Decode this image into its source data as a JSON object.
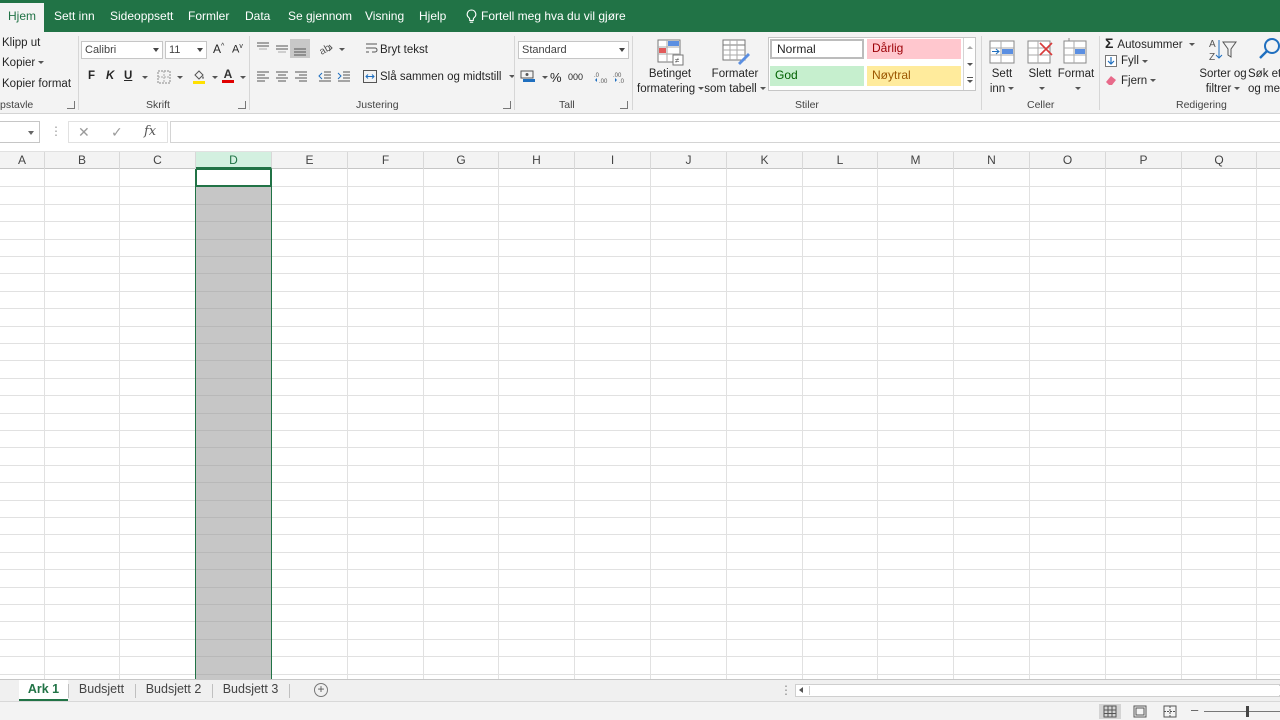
{
  "tabs": [
    {
      "label": "Hjem",
      "active": true
    },
    {
      "label": "Sett inn"
    },
    {
      "label": "Sideoppsett"
    },
    {
      "label": "Formler"
    },
    {
      "label": "Data"
    },
    {
      "label": "Se gjennom"
    },
    {
      "label": "Visning"
    },
    {
      "label": "Hjelp"
    }
  ],
  "tell_me": "Fortell meg hva du vil gjøre",
  "clipboard": {
    "cut": "Klipp ut",
    "copy": "Kopier",
    "format_painter": "Kopier format",
    "group_label": "pstavle"
  },
  "font": {
    "name": "Calibri",
    "size": "11",
    "bold": "F",
    "italic": "K",
    "underline": "U",
    "grow": "A",
    "shrink": "A",
    "color_letter": "A",
    "group_label": "Skrift"
  },
  "alignment": {
    "wrap_text": "Bryt tekst",
    "merge_center": "Slå sammen og midtstill",
    "group_label": "Justering"
  },
  "number": {
    "format": "Standard",
    "percent": "%",
    "thousands": "000",
    "group_label": "Tall"
  },
  "styles": {
    "conditional": [
      "Betinget",
      "formatering"
    ],
    "as_table": [
      "Formater",
      "som tabell"
    ],
    "normal": "Normal",
    "bad": "Dårlig",
    "good": "God",
    "neutral": "Nøytral",
    "group_label": "Stiler"
  },
  "cells": {
    "insert": [
      "Sett",
      "inn"
    ],
    "delete": "Slett",
    "format": "Format",
    "group_label": "Celler"
  },
  "editing": {
    "autosum": "Autosummer",
    "fill": "Fyll",
    "clear": "Fjern",
    "sort_filter": [
      "Sorter og",
      "filtrer"
    ],
    "find_select": [
      "Søk et",
      "og me"
    ],
    "group_label": "Redigering"
  },
  "formula_bar": {
    "cancel": "✕",
    "enter": "✓",
    "fx": "fx",
    "value": ""
  },
  "columns": [
    "A",
    "B",
    "C",
    "D",
    "E",
    "F",
    "G",
    "H",
    "I",
    "J",
    "K",
    "L",
    "M",
    "N",
    "O",
    "P",
    "Q"
  ],
  "selected_column": "D",
  "sheets": [
    {
      "label": "Ark 1",
      "active": true
    },
    {
      "label": "Budsjett"
    },
    {
      "label": "Budsjett 2"
    },
    {
      "label": "Budsjett 3"
    }
  ],
  "add_sheet": "+",
  "colors": {
    "accent": "#217346",
    "selection": "#c6c6c6",
    "bad_fill": "#ffc7ce",
    "good_fill": "#c6efce",
    "neutral_fill": "#ffeb9c"
  },
  "zoom_level": 0.55
}
